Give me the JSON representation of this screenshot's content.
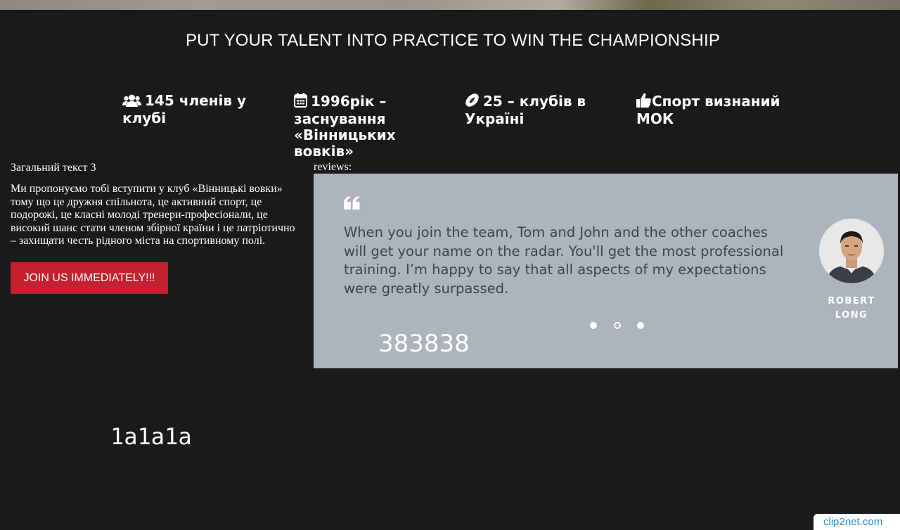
{
  "headline": "PUT YOUR TALENT INTO PRACTICE TO WIN THE CHAMPIONSHIP",
  "stats": [
    {
      "icon": "users-icon",
      "text": "145 членів у клубі"
    },
    {
      "icon": "calendar-icon",
      "text": "1996рік – заснування «Вінницьких вовків»"
    },
    {
      "icon": "football-icon",
      "text": "25 – клубів в Україні"
    },
    {
      "icon": "thumbs-up-icon",
      "text": "Спорт визнаний МОК"
    }
  ],
  "left": {
    "title": "Загальний текст 3",
    "body": "Ми пропонуємо тобі вступити у клуб «Вінницькі вовки» тому що це дружня спільнота, це активний спорт, це подорожі, це класні молоді тренери-професіонали, це високий шанс стати членом збірної країни і це патріотично – захищати честь рідного міста на спортивному полі.",
    "button_label": "JOIN US IMMEDIATELY!!!"
  },
  "reviews": {
    "label": "reviews:",
    "quote": "When you join the team, Tom and John and the other coaches will get your name on the radar. You'll get the most professional training. I’m happy to say that all aspects of my expectations were greatly surpassed.",
    "reviewer_first": "ROBERT",
    "reviewer_last": "LONG",
    "slides": 3,
    "active_slide": 2,
    "panel_code": "383838",
    "panel_color": "#adb4bd"
  },
  "page_code": "1a1a1a",
  "watermark": "clip2net.com",
  "colors": {
    "background": "#1a1a1a",
    "accent": "#c5202f",
    "review_text": "#3d4450"
  }
}
